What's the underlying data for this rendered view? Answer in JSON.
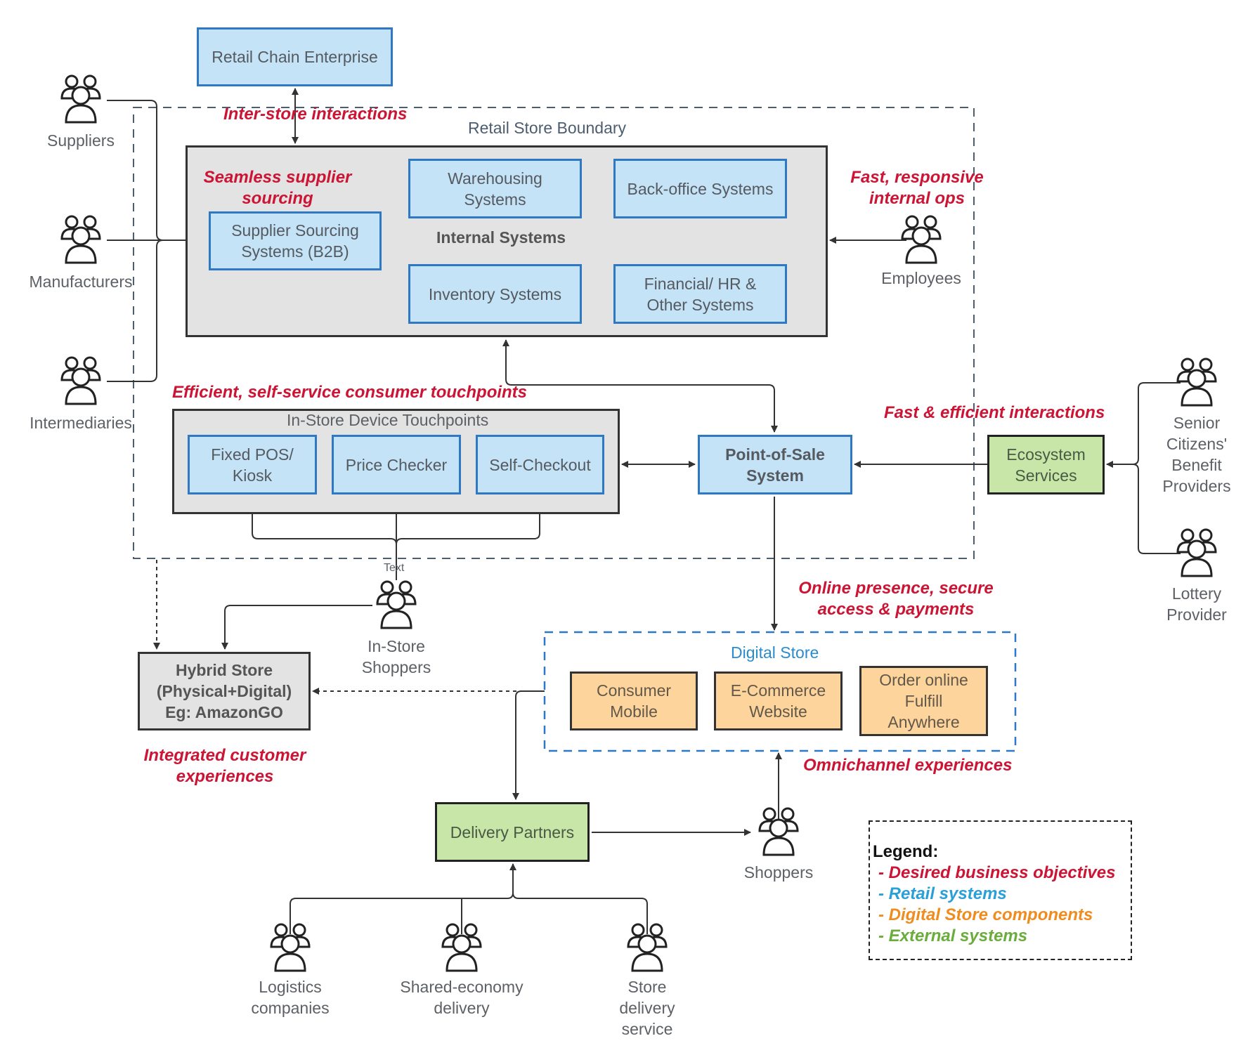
{
  "diagram": {
    "boundary_title": "Retail Store Boundary",
    "internal_systems_title": "Internal Systems",
    "touchpoints_title": "In-Store Device Touchpoints",
    "digital_store_title": "Digital Store",
    "connector_label": "Text"
  },
  "boxes": {
    "retail_chain": "Retail Chain Enterprise",
    "supplier_sourcing": "Supplier Sourcing Systems (B2B)",
    "warehousing": "Warehousing Systems",
    "back_office": "Back-office Systems",
    "inventory": "Inventory Systems",
    "financial": "Financial/ HR & Other Systems",
    "fixed_pos": "Fixed POS/ Kiosk",
    "price_checker": "Price Checker",
    "self_checkout": "Self-Checkout",
    "pos": "Point-of-Sale System",
    "ecosystem": "Ecosystem Services",
    "hybrid_store": "Hybrid Store (Physical+Digital) Eg: AmazonGO",
    "consumer_mobile": "Consumer Mobile",
    "ecommerce": "E-Commerce Website",
    "order_online": "Order online Fulfill Anywhere",
    "delivery_partners": "Delivery Partners"
  },
  "actors": {
    "suppliers": "Suppliers",
    "manufacturers": "Manufacturers",
    "intermediaries": "Intermediaries",
    "employees": "Employees",
    "senior_citizens": "Senior Citizens' Benefit Providers",
    "lottery": "Lottery Provider",
    "in_store_shoppers": "In-Store Shoppers",
    "shoppers": "Shoppers",
    "logistics": "Logistics companies",
    "shared_economy": "Shared-economy delivery",
    "store_delivery": "Store delivery service"
  },
  "objectives": {
    "inter_store": "Inter-store interactions",
    "seamless_supplier": "Seamless supplier sourcing",
    "fast_internal": "Fast, responsive internal ops",
    "self_service": "Efficient, self-service consumer touchpoints",
    "fast_efficient": "Fast & efficient interactions",
    "online_presence": "Online presence, secure access & payments",
    "integrated": "Integrated customer experiences",
    "omnichannel": "Omnichannel experiences"
  },
  "legend": {
    "title": "Legend:",
    "items": [
      {
        "label": "- Desired business objectives",
        "color": "#cc1434"
      },
      {
        "label": "- Retail systems",
        "color": "#2a9fd8"
      },
      {
        "label": "- Digital Store components",
        "color": "#f08c1e"
      },
      {
        "label": "- External systems",
        "color": "#6aad3c"
      }
    ]
  }
}
